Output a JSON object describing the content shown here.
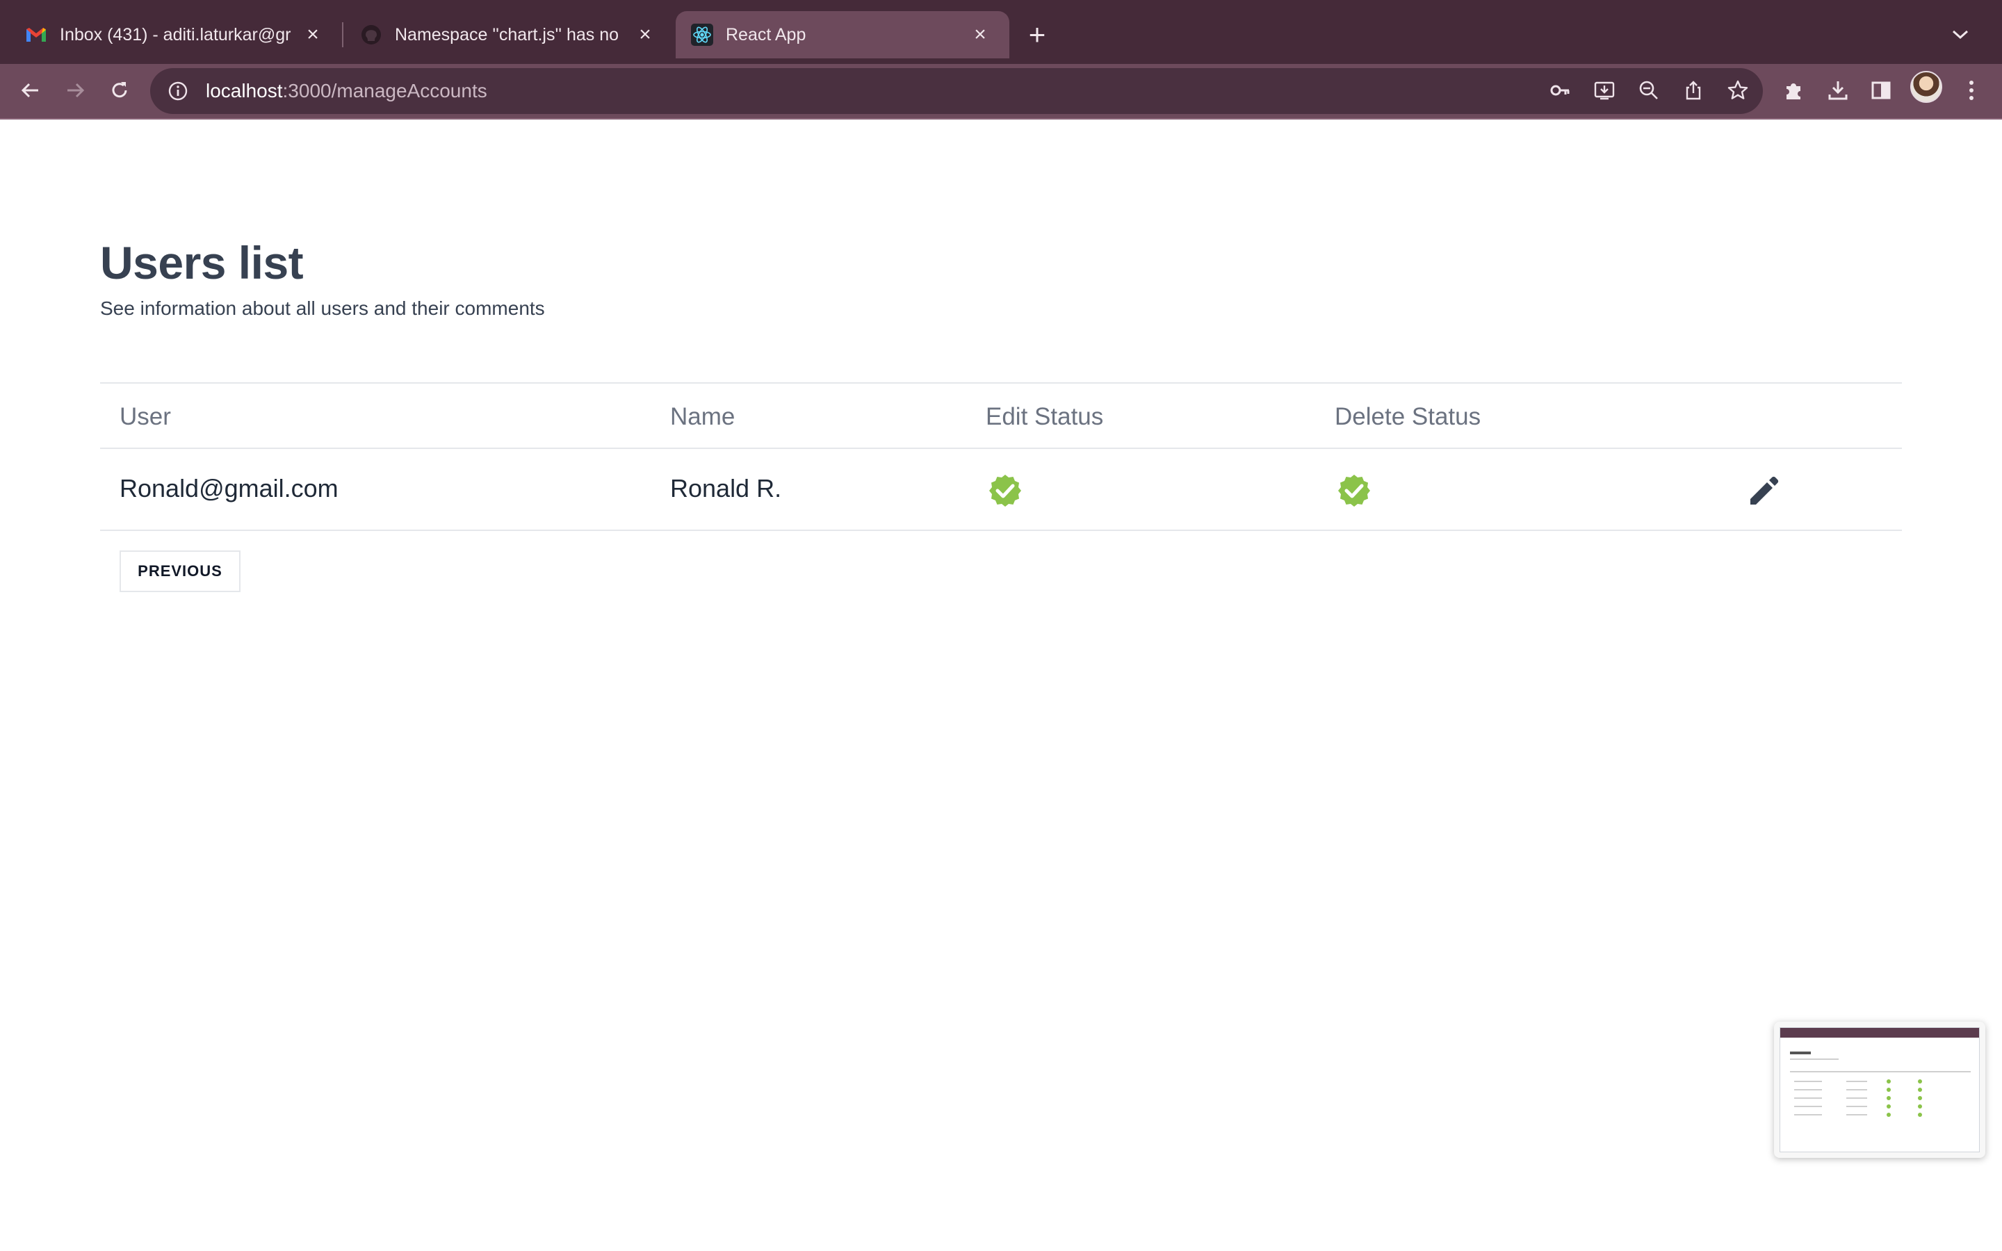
{
  "browser": {
    "tabs": [
      {
        "title": "Inbox (431) - aditi.laturkar@gr",
        "icon": "gmail-icon",
        "active": false
      },
      {
        "title": "Namespace ''chart.js'' has no",
        "icon": "github-icon",
        "active": false
      },
      {
        "title": "React App",
        "icon": "react-icon",
        "active": true
      }
    ],
    "url_host": "localhost",
    "url_path": ":3000/manageAccounts"
  },
  "page": {
    "title": "Users list",
    "subtitle": "See information about all users and their comments"
  },
  "table": {
    "headers": [
      "User",
      "Name",
      "Edit Status",
      "Delete Status"
    ],
    "rows": [
      {
        "user": "Ronald@gmail.com",
        "name": "Ronald R.",
        "edit_status": "verified-icon",
        "delete_status": "verified-icon",
        "action": "edit-icon"
      }
    ]
  },
  "pagination": {
    "previous_label": "PREVIOUS"
  },
  "colors": {
    "chrome_dark": "#452a39",
    "chrome_toolbar": "#6d4a5c",
    "verified_green": "#8bc34a",
    "heading": "#374151"
  }
}
